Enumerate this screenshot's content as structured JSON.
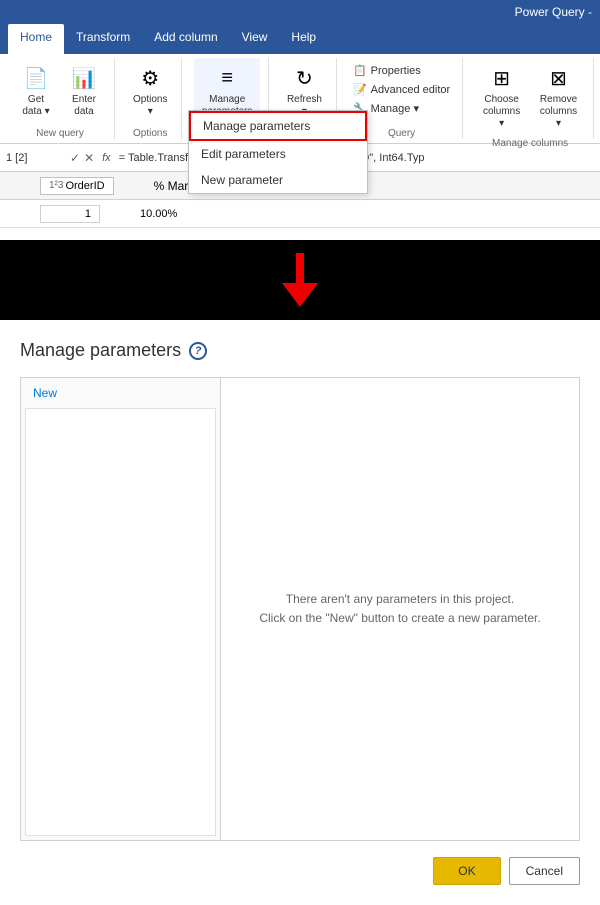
{
  "titleBar": {
    "text": "Power Query -"
  },
  "tabs": [
    {
      "label": "Home",
      "active": true
    },
    {
      "label": "Transform",
      "active": false
    },
    {
      "label": "Add column",
      "active": false
    },
    {
      "label": "View",
      "active": false
    },
    {
      "label": "Help",
      "active": false
    }
  ],
  "ribbon": {
    "groups": [
      {
        "name": "new-query",
        "label": "New query",
        "buttons": [
          {
            "id": "get-data",
            "icon": "📄",
            "label": "Get\ndata ▾"
          },
          {
            "id": "enter-data",
            "icon": "📊",
            "label": "Enter\ndata"
          }
        ]
      },
      {
        "name": "options",
        "label": "Options",
        "buttons": [
          {
            "id": "options",
            "icon": "⚙",
            "label": "Options\n▾"
          }
        ]
      },
      {
        "name": "manage-params",
        "label": "",
        "buttons": [
          {
            "id": "manage-parameters",
            "icon": "≡",
            "label": "Manage\nparameters ▾"
          }
        ]
      },
      {
        "name": "refresh-group",
        "label": "",
        "buttons": [
          {
            "id": "refresh",
            "icon": "↻",
            "label": "Refresh\n▾"
          }
        ]
      },
      {
        "name": "query",
        "label": "Query",
        "smallButtons": [
          {
            "id": "properties",
            "label": "Properties"
          },
          {
            "id": "advanced-editor",
            "label": "Advanced editor"
          },
          {
            "id": "manage",
            "label": "Manage ▾"
          }
        ]
      },
      {
        "name": "manage-columns",
        "label": "Manage columns",
        "buttons": [
          {
            "id": "choose-columns",
            "icon": "⊞",
            "label": "Choose\ncolumns ▾"
          },
          {
            "id": "remove-columns",
            "icon": "⊠",
            "label": "Remove\ncolumns ▾"
          }
        ]
      }
    ]
  },
  "dropdownMenu": {
    "items": [
      {
        "id": "manage-parameters-item",
        "label": "Manage parameters",
        "highlighted": true
      },
      {
        "id": "edit-parameters",
        "label": "Edit parameters"
      },
      {
        "id": "new-parameter",
        "label": "New parameter"
      }
    ]
  },
  "formulaBar": {
    "nameBox": "1 [2]",
    "fx": "fx",
    "formula": "= Table.TransformColumnTypes(Source, {{\"OrderID\", Int64.Typ"
  },
  "sheet": {
    "column": {
      "icon": "123",
      "name": "OrderID"
    },
    "cell": "1",
    "marginLabel": "% Margin",
    "marginValue": "10.00%"
  },
  "arrow": {
    "color": "#dd0000"
  },
  "dialog": {
    "title": "Manage parameters",
    "helpIcon": "?",
    "newLink": "New",
    "emptyMessage1": "There aren't any parameters in this project.",
    "emptyMessage2": "Click on the \"New\" button to create a new parameter.",
    "okLabel": "OK",
    "cancelLabel": "Cancel"
  }
}
